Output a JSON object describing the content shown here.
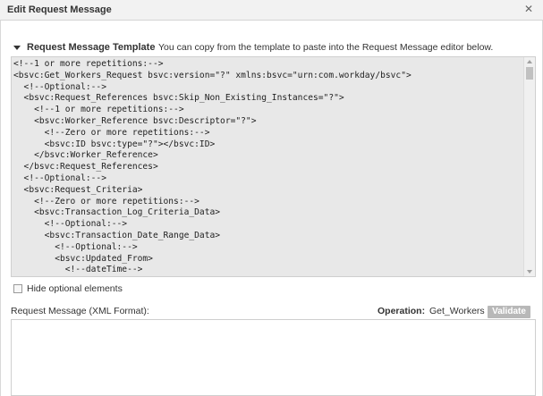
{
  "dialog": {
    "title": "Edit Request Message"
  },
  "template_section": {
    "label": "Request Message Template",
    "hint": "You can copy from the template to paste into the Request Message editor below.",
    "code_lines": [
      "<!--1 or more repetitions:-->",
      "<bsvc:Get_Workers_Request bsvc:version=\"?\" xmlns:bsvc=\"urn:com.workday/bsvc\">",
      "  <!--Optional:-->",
      "  <bsvc:Request_References bsvc:Skip_Non_Existing_Instances=\"?\">",
      "    <!--1 or more repetitions:-->",
      "    <bsvc:Worker_Reference bsvc:Descriptor=\"?\">",
      "      <!--Zero or more repetitions:-->",
      "      <bsvc:ID bsvc:type=\"?\"></bsvc:ID>",
      "    </bsvc:Worker_Reference>",
      "  </bsvc:Request_References>",
      "  <!--Optional:-->",
      "  <bsvc:Request_Criteria>",
      "    <!--Zero or more repetitions:-->",
      "    <bsvc:Transaction_Log_Criteria_Data>",
      "      <!--Optional:-->",
      "      <bsvc:Transaction_Date_Range_Data>",
      "        <!--Optional:-->",
      "        <bsvc:Updated_From>",
      "          <!--dateTime-->"
    ]
  },
  "options": {
    "hide_optional_label": "Hide optional elements"
  },
  "request": {
    "label": "Request Message (XML Format):",
    "operation_label": "Operation:",
    "operation_value": "Get_Workers",
    "validate_label": "Validate",
    "value": ""
  }
}
